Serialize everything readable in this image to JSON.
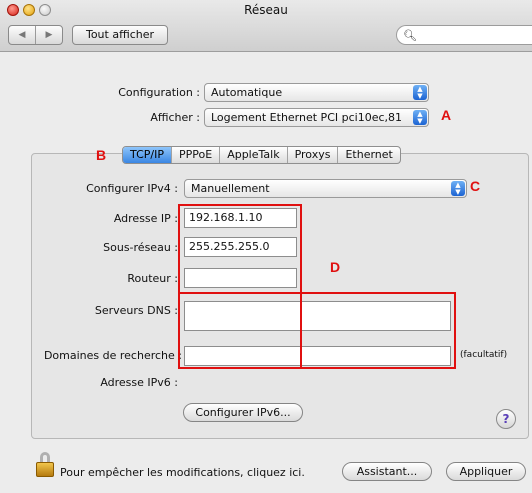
{
  "window": {
    "title": "Réseau"
  },
  "toolbar": {
    "back": "◀",
    "forward": "▶",
    "show_all": "Tout afficher",
    "search_placeholder": ""
  },
  "config": {
    "configuration_label": "Configuration :",
    "configuration_value": "Automatique",
    "show_label": "Afficher :",
    "show_value": "Logement Ethernet PCI pci10ec,81"
  },
  "tabs": [
    "TCP/IP",
    "PPPoE",
    "AppleTalk",
    "Proxys",
    "Ethernet"
  ],
  "active_tab": "TCP/IP",
  "tcpip": {
    "ipv4_label": "Configurer IPv4 :",
    "ipv4_value": "Manuellement",
    "ip_label": "Adresse IP :",
    "ip_value": "192.168.1.10",
    "subnet_label": "Sous-réseau :",
    "subnet_value": "255.255.255.0",
    "router_label": "Routeur :",
    "router_value": "",
    "dns_label": "Serveurs DNS :",
    "dns_value": "",
    "search_domains_label": "Domaines de recherche :",
    "search_domains_value": "",
    "optional": "(facultatif)",
    "ipv6_label": "Adresse IPv6 :",
    "ipv6_button": "Configurer IPv6..."
  },
  "footer": {
    "lock_text": "Pour empêcher les modifications, cliquez ici.",
    "assistant_button": "Assistant...",
    "apply_button": "Appliquer"
  },
  "annotations": {
    "a": "A",
    "b": "B",
    "c": "C",
    "d": "D"
  },
  "colors": {
    "annotation": "#e01010",
    "accent": "#3a86e3"
  }
}
